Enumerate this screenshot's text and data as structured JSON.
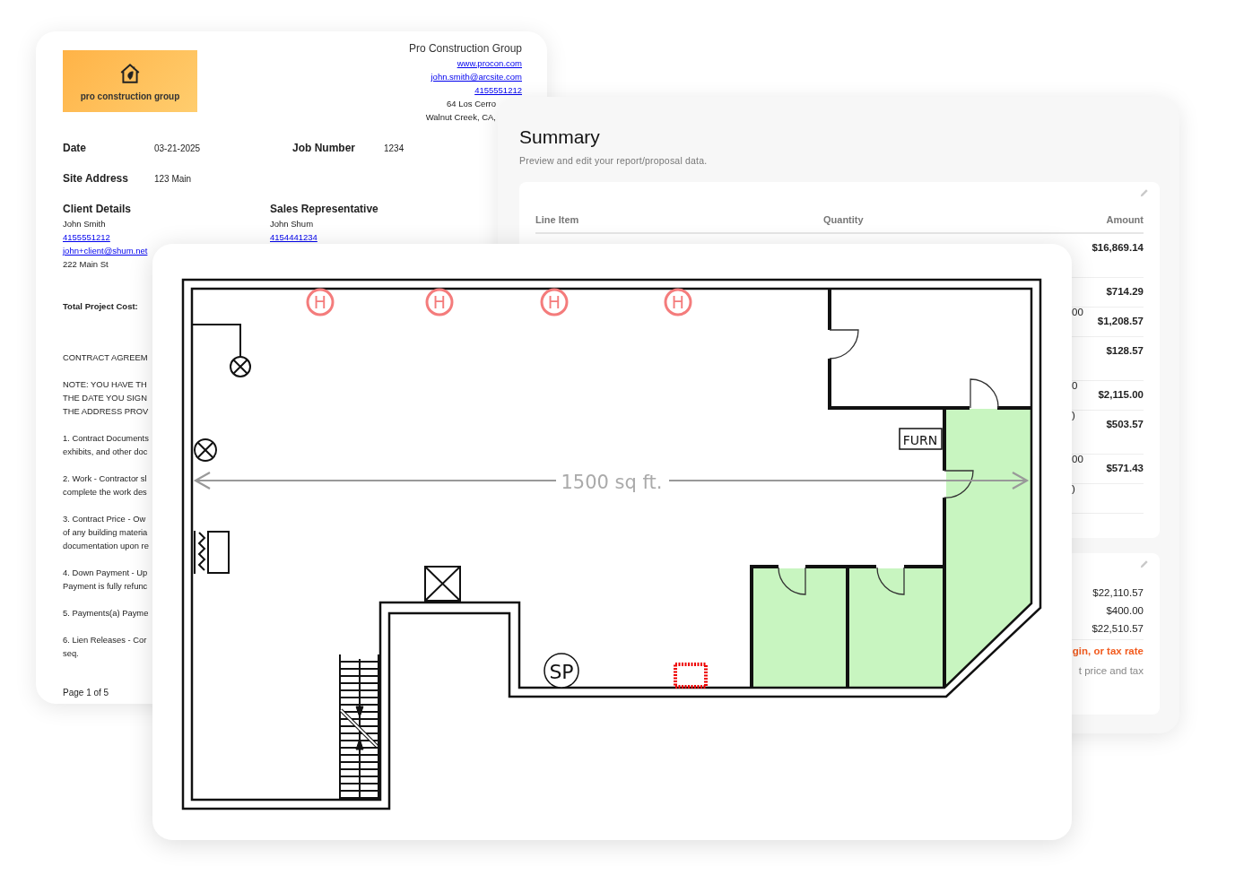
{
  "document": {
    "logo_text": "pro construction group",
    "company": {
      "name": "Pro Construction Group",
      "links": [
        "www.procon.com",
        "john.smith@arcsite.com",
        "4155551212"
      ],
      "address_lines": [
        "64 Los Cerro",
        "Walnut Creek, CA,"
      ]
    },
    "fields": [
      {
        "label": "Date",
        "value": "03-21-2025"
      },
      {
        "label": "Job Number",
        "value": "1234"
      },
      {
        "label": "Site Address",
        "value": "123 Main"
      }
    ],
    "contacts": [
      {
        "heading": "Client Details",
        "lines": [
          {
            "kind": "text",
            "text": "John Smith"
          },
          {
            "kind": "link",
            "text": "4155551212"
          },
          {
            "kind": "link",
            "text": "john+client@shum.net"
          },
          {
            "kind": "text",
            "text": "222 Main St"
          }
        ]
      },
      {
        "heading": "Sales Representative",
        "lines": [
          {
            "kind": "text",
            "text": "John Shum"
          },
          {
            "kind": "link",
            "text": "4154441234"
          }
        ]
      }
    ],
    "total_label": "Total Project Cost:",
    "paragraphs": [
      {
        "lines": [
          "CONTRACT AGREEM"
        ]
      },
      {
        "lines": [
          "NOTE: YOU HAVE TH",
          "THE DATE YOU SIGN",
          "THE ADDRESS PROV"
        ]
      },
      {
        "lines": [
          "1. Contract Documents",
          "exhibits, and other doc"
        ]
      },
      {
        "lines": [
          "2. Work - Contractor sl",
          "complete the work des"
        ]
      },
      {
        "lines": [
          "3. Contract Price - Ow",
          "of any building materia",
          "documentation upon re"
        ]
      },
      {
        "lines": [
          "4. Down Payment - Up",
          "Payment is fully refunc"
        ]
      },
      {
        "lines": [
          "5. Payments(a) Payme"
        ]
      },
      {
        "lines": [
          "6. Lien Releases - Cor",
          "seq."
        ]
      }
    ],
    "page_label": "Page 1 of 5"
  },
  "summary": {
    "title": "Summary",
    "subtitle": "Preview and edit your report/proposal data.",
    "table": {
      "columns": [
        "Line Item",
        "Quantity",
        "Amount"
      ],
      "rows": [
        {
          "amount": "$16,869.14"
        },
        {
          "amount": "$714.29"
        },
        {
          "quantity": "00",
          "amount": "$1,208.57"
        },
        {
          "amount": "$128.57"
        },
        {
          "quantity": "0",
          "amount": "$2,115.00"
        },
        {
          "quantity": ")",
          "amount": "$503.57"
        },
        {
          "quantity": "00",
          "amount": "$571.43"
        },
        {
          "quantity": ")"
        }
      ]
    },
    "totals": [
      "$22,110.57",
      "$400.00",
      "$22,510.57"
    ],
    "warning": "gin, or tax rate",
    "note": "t price and tax"
  },
  "floor_plan": {
    "heater_labels": [
      "H",
      "H",
      "H",
      "H"
    ],
    "dimension_label": "1500 sq ft.",
    "furnace_label": "FURN",
    "sp_label": "SP"
  }
}
